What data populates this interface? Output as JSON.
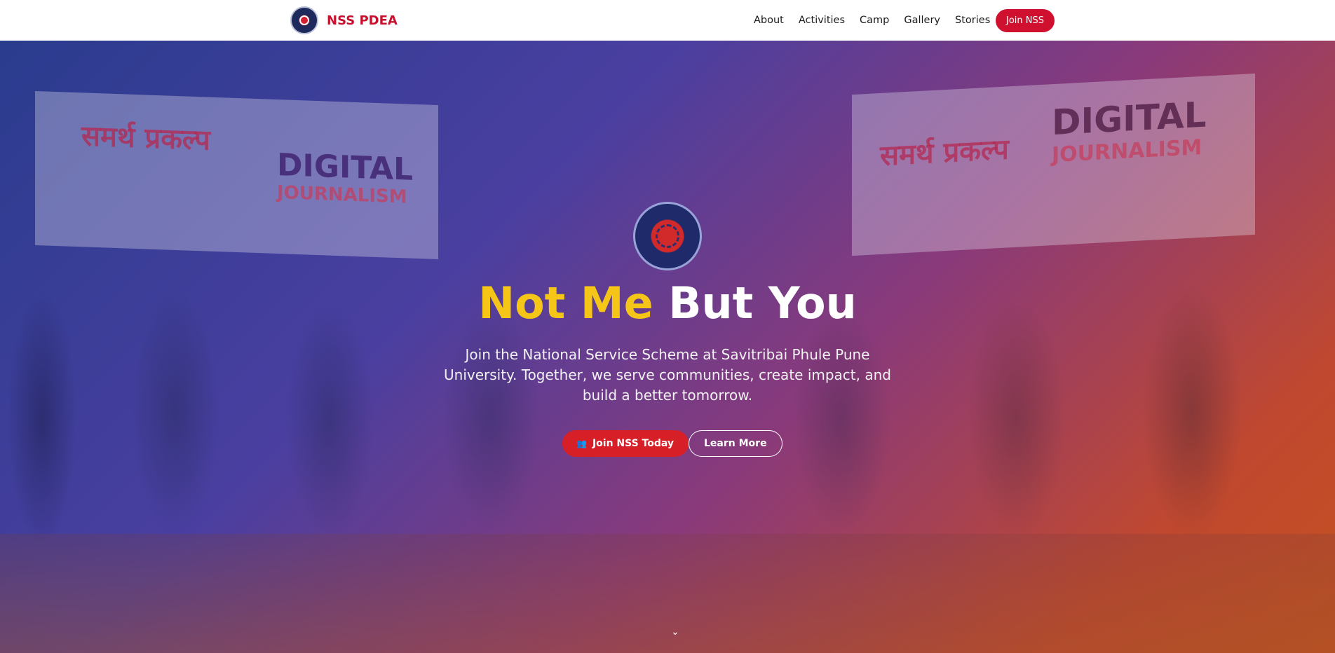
{
  "nav": {
    "brand": "NSS PDEA",
    "links": [
      "About",
      "Activities",
      "Camp",
      "Gallery",
      "Stories"
    ],
    "cta": "Join NSS"
  },
  "hero": {
    "headline_highlight": "Not Me",
    "headline_rest": "But You",
    "subtext": "Join the National Service Scheme at Savitribai Phule Pune University. Together, we serve communities, create impact, and build a better tomorrow.",
    "primary_button": "Join NSS Today",
    "primary_button_icon": "users-icon",
    "secondary_button": "Learn More",
    "scroll_icon": "chevron-down-icon",
    "banner_left": {
      "text1": "समर्थ प्रकल्प",
      "text2": "DIGITAL",
      "text3": "JOURNALISM"
    },
    "banner_right": {
      "text1": "समर्थ प्रकल्प",
      "text2": "DIGITAL",
      "text3": "JOURNALISM"
    }
  },
  "colors": {
    "brand": "#c8102e",
    "accent_yellow": "#f5c518",
    "primary_button": "#d71f27"
  }
}
